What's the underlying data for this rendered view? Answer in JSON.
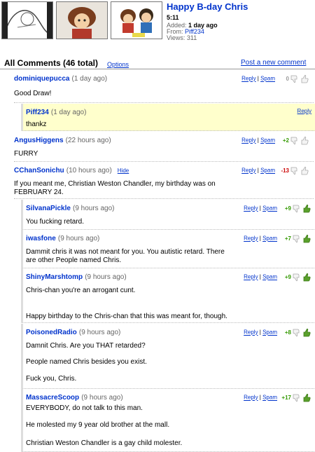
{
  "video": {
    "title": "Happy B-day Chris",
    "duration": "5:11",
    "added_label": "Added:",
    "added": "1 day ago",
    "from_label": "From:",
    "from": "Piff234",
    "views_label": "Views:",
    "views": "311"
  },
  "comments_header": {
    "title": "All Comments (46 total)",
    "options": "Options",
    "post_new": "Post a new comment"
  },
  "labels": {
    "reply": "Reply",
    "spam": "Spam",
    "sep": "|",
    "hide": "Hide"
  },
  "comments": [
    {
      "author": "dominiquepucca",
      "age": "(1 day ago)",
      "score": "0",
      "lines": [
        "Good Draw!"
      ]
    },
    {
      "author": "Piff234",
      "age": "(1 day ago)",
      "lines": [
        "thankz"
      ]
    },
    {
      "author": "AngusHiggens",
      "age": "(22 hours ago)",
      "score": "+2",
      "lines": [
        "FURRY"
      ]
    },
    {
      "author": "CChanSonichu",
      "age": "(10 hours ago)",
      "score": "-13",
      "lines": [
        "If you meant me, Christian Weston Chandler, my birthday was on",
        "FEBRUARY 24."
      ]
    },
    {
      "author": "SilvanaPickle",
      "age": "(9 hours ago)",
      "score": "+9",
      "lines": [
        "You fucking retard."
      ]
    },
    {
      "author": "iwasfone",
      "age": "(9 hours ago)",
      "score": "+7",
      "lines": [
        "Dammit chris it was not meant for you. You autistic retard. There",
        "are other People named Chris."
      ]
    },
    {
      "author": "ShinyMarshtomp",
      "age": "(9 hours ago)",
      "score": "+9",
      "lines": [
        "Chris-chan you're an arrogant cunt.",
        "Happy birthday to the Chris-chan that this was meant for, though."
      ]
    },
    {
      "author": "PoisonedRadio",
      "age": "(9 hours ago)",
      "score": "+8",
      "lines": [
        "Damnit Chris. Are you THAT retarded?",
        "People named Chris besides you exist.",
        "Fuck you, Chris."
      ]
    },
    {
      "author": "MassacreScoop",
      "age": "(9 hours ago)",
      "score": "+17",
      "lines": [
        "EVERYBODY, do not talk to this man.",
        "He molested my 9 year old brother at the mall.",
        "Christian Weston Chandler is a gay child molester."
      ]
    }
  ]
}
